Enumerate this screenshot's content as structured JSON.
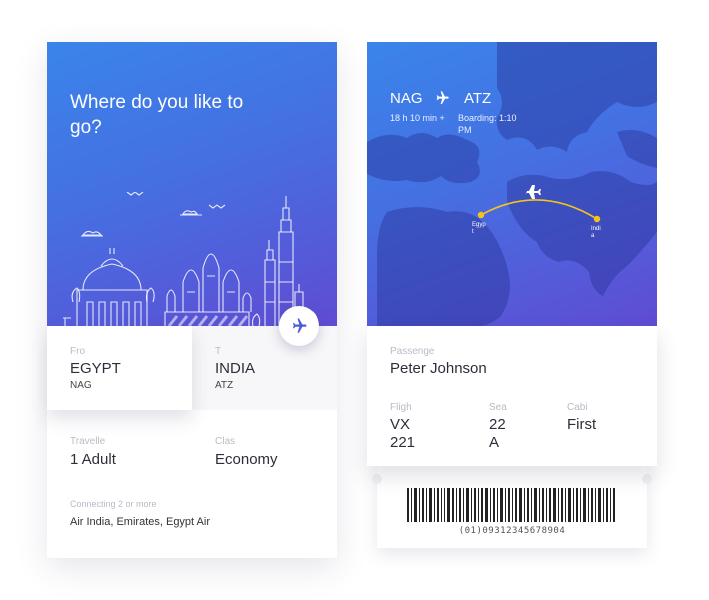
{
  "search_card": {
    "title": "Where do you like to go?",
    "from": {
      "label": "Fro",
      "city": "EGYPT",
      "code": "NAG"
    },
    "to": {
      "label": "T",
      "city": "INDIA",
      "code": "ATZ"
    },
    "travellers": {
      "label": "Travelle",
      "value": "1 Adult"
    },
    "class": {
      "label": "Clas",
      "value": "Economy"
    },
    "connecting": {
      "label": "Connecting 2 or more",
      "value": "Air India, Emirates, Egypt Air"
    },
    "swap_icon": "airplane-icon"
  },
  "ticket_card": {
    "origin": "NAG",
    "destination": "ATZ",
    "duration": "18 h 10 min +",
    "boarding": "Boarding: 1:10 PM",
    "map_origin_label": "Egyp t",
    "map_destination_label": "Indi a",
    "passenger": {
      "label": "Passenge",
      "value": "Peter Johnson"
    },
    "flight": {
      "label": "Fligh",
      "value": "VX 221"
    },
    "seat": {
      "label": "Sea",
      "value": "22 A"
    },
    "cabin": {
      "label": "Cabi",
      "value": "First"
    },
    "barcode_number": "(01)09312345678904"
  },
  "colors": {
    "gradient_top": "#3a84ea",
    "gradient_bottom": "#5f4cd3",
    "accent": "#4a5bd8",
    "route": "#f5c31b"
  }
}
